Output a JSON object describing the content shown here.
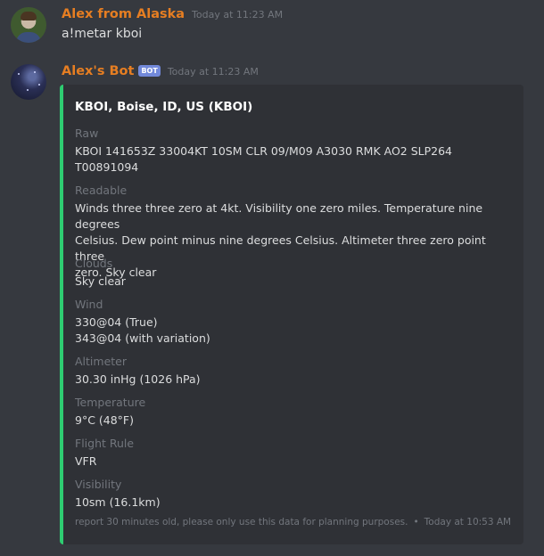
{
  "messages": [
    {
      "author": "Alex from Alaska",
      "timestamp": "Today at 11:23 AM",
      "text": "a!metar kboi"
    },
    {
      "author": "Alex's Bot",
      "bot_tag": "BOT",
      "timestamp": "Today at 11:23 AM"
    }
  ],
  "embed": {
    "accent_color": "#2ecc71",
    "title": "KBOI, Boise, ID, US (KBOI)",
    "fields": {
      "raw": {
        "name": "Raw",
        "lines": [
          "KBOI 141653Z 33004KT 10SM CLR 09/M09 A3030 RMK AO2 SLP264",
          "T00891094"
        ]
      },
      "readable": {
        "name": "Readable",
        "lines": [
          "Winds three three zero at 4kt. Visibility one zero miles. Temperature nine degrees",
          "Celsius. Dew point minus nine degrees Celsius. Altimeter three zero point three",
          "zero. Sky clear"
        ]
      },
      "clouds": {
        "name": "Clouds",
        "lines": [
          "Sky clear"
        ]
      },
      "wind": {
        "name": "Wind",
        "lines": [
          "330@04 (True)",
          "343@04 (with variation)"
        ]
      },
      "altimeter": {
        "name": "Altimeter",
        "lines": [
          "30.30 inHg (1026 hPa)"
        ]
      },
      "temperature": {
        "name": "Temperature",
        "lines": [
          "9°C (48°F)"
        ]
      },
      "flight_rule": {
        "name": "Flight Rule",
        "lines": [
          "VFR"
        ]
      },
      "visibility": {
        "name": "Visibility",
        "lines": [
          "10sm (16.1km)"
        ]
      }
    },
    "footer": {
      "text": "report 30 minutes old, please only use this data for planning purposes.",
      "separator": "•",
      "timestamp": "Today at 10:53 AM"
    }
  },
  "colors": {
    "background": "#36393f",
    "embed_background": "#2f3136",
    "username": "#e67e22",
    "bot_tag": "#7289da"
  }
}
